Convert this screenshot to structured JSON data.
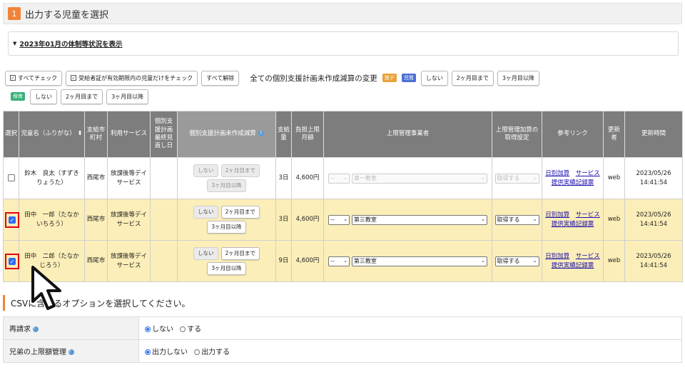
{
  "step": {
    "number": "1",
    "title": "出力する児童を選択"
  },
  "collapse": {
    "label": "2023年01月の体制等状況を表示"
  },
  "toolbar": {
    "check_all": "すべてチェック",
    "check_valid": "受給者証が有効期限内の児童だけをチェック",
    "uncheck_all": "すべて解除",
    "bulk_label": "全ての個別支援計画未作成減算の変更",
    "tag1": "放デ",
    "tag2": "児発",
    "tag3": "保育",
    "none": "しない",
    "two_months": "2ヶ月目まで",
    "three_months": "3ヶ月目以降"
  },
  "table": {
    "headers": {
      "select": "選択",
      "name": "児童名（ふりがな）",
      "city": "支給市町村",
      "service": "利用サービス",
      "plan_date": "個別支援計画最終見直し日",
      "plan_reduction": "個別支援計画未作成減算",
      "amount": "支給量",
      "limit": "負担上限月額",
      "provider": "上限管理事業者",
      "addition": "上限管理加算の取得設定",
      "links": "参考リンク",
      "updater": "更新者",
      "updated": "更新時間"
    },
    "rows": [
      {
        "checked": false,
        "name": "鈴木　良太（すずき　りょうた）",
        "city": "西尾市",
        "service": "放課後等デイサービス",
        "plan_date": "",
        "amount": "3日",
        "limit": "4,600円",
        "provider_type": "--",
        "provider_name": "第一教室",
        "addition": "取得する",
        "link1": "日別加算",
        "link2": "サービス提供実績記録票",
        "updater": "web",
        "updated_date": "2023/05/26",
        "updated_time": "14:41:54"
      },
      {
        "checked": true,
        "name": "田中　一郎（たなか　いちろう）",
        "city": "西尾市",
        "service": "放課後等デイサービス",
        "plan_date": "",
        "amount": "3日",
        "limit": "4,600円",
        "provider_type": "--",
        "provider_name": "第三教室",
        "addition": "取得する",
        "link1": "日別加算",
        "link2": "サービス提供実績記録票",
        "updater": "web",
        "updated_date": "2023/05/26",
        "updated_time": "14:41:54"
      },
      {
        "checked": true,
        "name": "田中　二郎（たなか　じろう）",
        "city": "西尾市",
        "service": "放課後等デイサービス",
        "plan_date": "",
        "amount": "9日",
        "limit": "4,600円",
        "provider_type": "--",
        "provider_name": "第三教室",
        "addition": "取得する",
        "link1": "日別加算",
        "link2": "サービス提供実績記録票",
        "updater": "web",
        "updated_date": "2023/05/26",
        "updated_time": "14:41:54"
      }
    ]
  },
  "csv": {
    "title": "CSVに含めるオプションを選択してください。",
    "options": [
      {
        "label": "再請求",
        "opt1": "しない",
        "opt2": "する"
      },
      {
        "label": "兄弟の上限額管理",
        "opt1": "出力しない",
        "opt2": "出力する"
      }
    ]
  },
  "colors": {
    "accent": "#f0843a",
    "selected_row": "#fbeeb8",
    "header": "#7d7d7d",
    "highlight": "#e60012",
    "tag_hode": "#e8a33a",
    "tag_jihatsu": "#4b6fd6",
    "tag_hoiku": "#37b07a"
  }
}
